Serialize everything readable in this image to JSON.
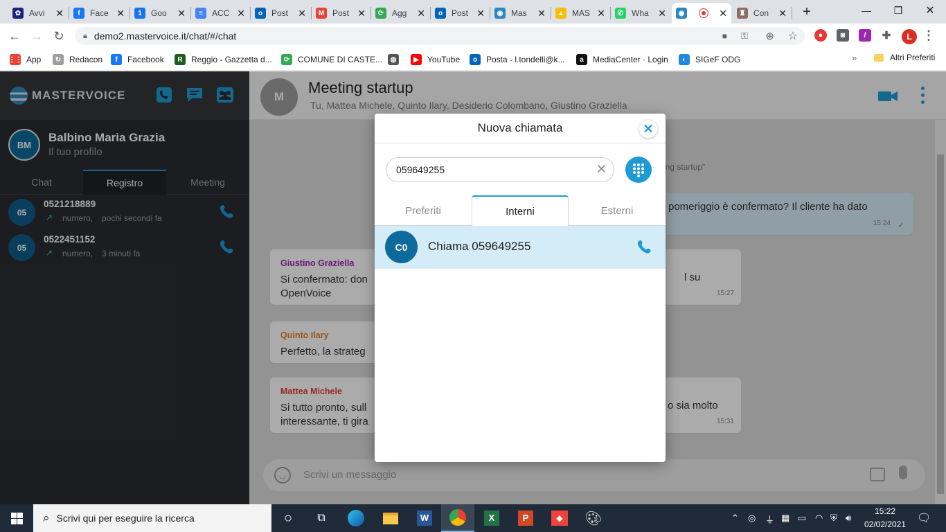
{
  "browser": {
    "tabs": [
      {
        "title": "Avvi",
        "fav_color": "#1a237e",
        "fav_glyph": "✿"
      },
      {
        "title": "Face",
        "fav_color": "#1877f2",
        "fav_glyph": "f"
      },
      {
        "title": "Goo",
        "fav_color": "#1a73e8",
        "fav_glyph": "1"
      },
      {
        "title": "ACC",
        "fav_color": "#4285f4",
        "fav_glyph": "≡"
      },
      {
        "title": "Post",
        "fav_color": "#0364b8",
        "fav_glyph": "o"
      },
      {
        "title": "Post",
        "fav_color": "#ea4335",
        "fav_glyph": "M"
      },
      {
        "title": "Agg",
        "fav_color": "#34a853",
        "fav_glyph": "⟳"
      },
      {
        "title": "Post",
        "fav_color": "#0364b8",
        "fav_glyph": "o"
      },
      {
        "title": "Mas",
        "fav_color": "#2e86c1",
        "fav_glyph": "◉"
      },
      {
        "title": "MAS",
        "fav_color": "#fbbc04",
        "fav_glyph": "▲"
      },
      {
        "title": "Wha",
        "fav_color": "#25d366",
        "fav_glyph": "✆"
      },
      {
        "title": "",
        "fav_color": "#2e86c1",
        "fav_glyph": "◉"
      },
      {
        "title": "Con",
        "fav_color": "#8d6e63",
        "fav_glyph": "♜"
      }
    ],
    "url": "demo2.mastervoice.it/chat/#/chat",
    "bookmarks": [
      {
        "label": "App",
        "color": "#ea4335",
        "glyph": "⋮⋮"
      },
      {
        "label": "Redacon",
        "color": "#9e9e9e",
        "glyph": "↻"
      },
      {
        "label": "Facebook",
        "color": "#1877f2",
        "glyph": "f"
      },
      {
        "label": "Reggio - Gazzetta d...",
        "color": "#1b5e20",
        "glyph": "R"
      },
      {
        "label": "COMUNE DI CASTE...",
        "color": "#34a853",
        "glyph": "⟳"
      },
      {
        "label": "",
        "color": "#555555",
        "glyph": "◍"
      },
      {
        "label": "YouTube",
        "color": "#ff0000",
        "glyph": "▶"
      },
      {
        "label": "Posta - l.tondelli@k...",
        "color": "#0364b8",
        "glyph": "o"
      },
      {
        "label": "MediaCenter · Login",
        "color": "#111111",
        "glyph": "a"
      },
      {
        "label": "SIGeF ODG",
        "color": "#1e88e5",
        "glyph": "◐"
      }
    ],
    "bookmarks_more": "»",
    "other_bookmarks": "Altri Preferiti",
    "profile_initial": "L"
  },
  "app": {
    "brand": "MASTERVOICE",
    "profile": {
      "initials": "BM",
      "name": "Balbino Maria Grazia",
      "subtitle": "Il tuo profilo"
    },
    "subtabs": [
      "Chat",
      "Registro",
      "Meeting"
    ],
    "calls": [
      {
        "initials": "05",
        "number": "0521218889",
        "meta": "numero,",
        "time": "pochi secondi fa"
      },
      {
        "initials": "05",
        "number": "0522451152",
        "meta": "numero,",
        "time": "3 minuti fa"
      }
    ],
    "chat": {
      "avatar": "M",
      "title": "Meeting startup",
      "participants": "Tu, Mattea Michele, Quinto Ilary, Desiderio Colombano, Giustino Graziella",
      "system_fragment": "ing startup\"",
      "my_message": {
        "text": "pomeriggio è confermato? Il cliente ha dato",
        "time": "15:24"
      },
      "messages": [
        {
          "sender": "Giustino Graziella",
          "color": "#9c27b0",
          "line1_left": "Si confermato: don",
          "line1_right": "l su",
          "line2": "OpenVoice",
          "time": "15:27"
        },
        {
          "sender": "Quinto Ilary",
          "color": "#e67e22",
          "line1_left": "Perfetto, la strateg",
          "line1_right": "",
          "line2": "",
          "time": ""
        },
        {
          "sender": "Mattea Michele",
          "color": "#e53935",
          "line1_left": "Si tutto pronto, sull",
          "line1_right": "o sia molto",
          "line2": "interessante, ti gira",
          "time": "15:31"
        }
      ],
      "composer_placeholder": "Scrivi un messaggio"
    },
    "modal": {
      "title": "Nuova chiamata",
      "search_value": "059649255",
      "tabs": [
        "Preferiti",
        "Interni",
        "Esterni"
      ],
      "active_tab": "Interni",
      "result": {
        "initials": "C0",
        "label": "Chiama 059649255"
      }
    }
  },
  "taskbar": {
    "search_placeholder": "Scrivi qui per eseguire la ricerca",
    "time": "15:22",
    "date": "02/02/2021"
  }
}
